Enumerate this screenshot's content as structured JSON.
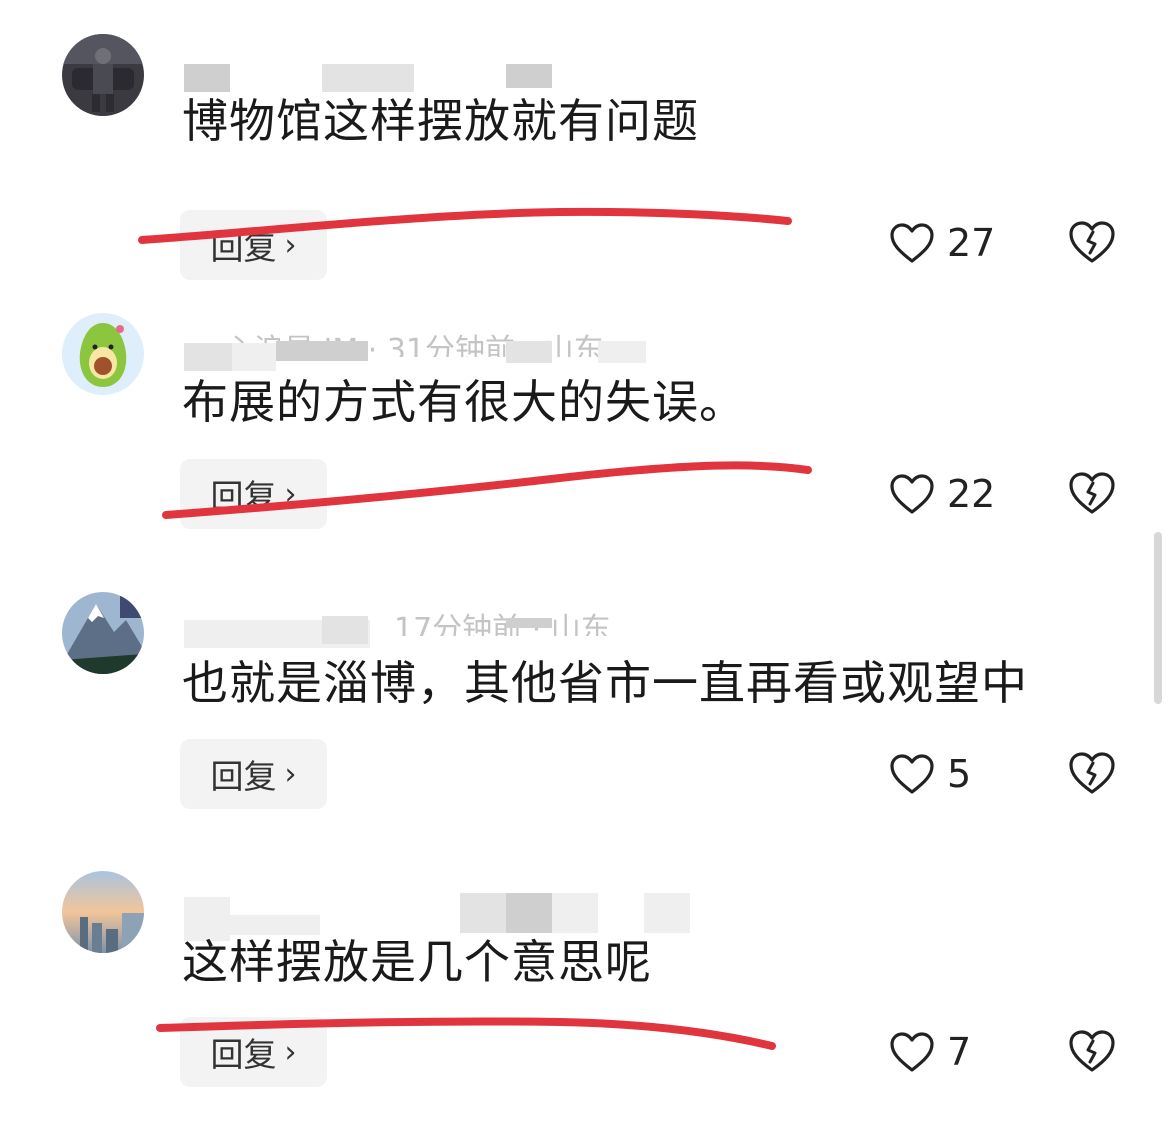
{
  "comments": [
    {
      "avatar": "armored-figure",
      "meta": "",
      "text": "博物馆这样摆放就有问题",
      "reply_label": "回复",
      "likes": "27"
    },
    {
      "avatar": "avocado",
      "meta": "心浪星 IM · 31分钟前 · 山东",
      "text": "布展的方式有很大的失误。",
      "reply_label": "回复",
      "likes": "22"
    },
    {
      "avatar": "mountain",
      "meta": "17分钟前 · 山东",
      "text": "也就是淄博，其他省市一直再看或观望中",
      "reply_label": "回复",
      "likes": "5"
    },
    {
      "avatar": "sunset-city",
      "meta": "",
      "text": "这样摆放是几个意思呢",
      "reply_label": "回复",
      "likes": "7"
    }
  ],
  "icons": {
    "reply_chevron": "chevron-right",
    "like": "heart-outline",
    "dislike": "broken-heart-outline"
  },
  "colors": {
    "annotation_underline": "#e0353f",
    "reply_bg": "#f3f3f3"
  }
}
